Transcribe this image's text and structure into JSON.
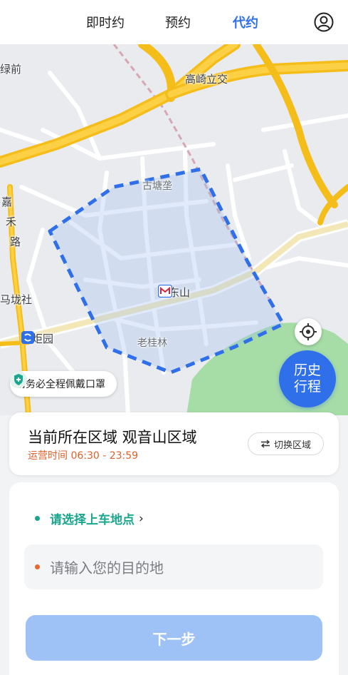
{
  "tabs": [
    {
      "label": "即时约",
      "active": false
    },
    {
      "label": "预约",
      "active": false
    },
    {
      "label": "代约",
      "active": true
    }
  ],
  "header": {
    "user_icon": "user-icon"
  },
  "map": {
    "labels": {
      "lu_qian": "绿前",
      "gaoqi": "高崎立交",
      "gutangke": "古塘垄",
      "jiahe_road": [
        "嘉",
        "禾",
        "路"
      ],
      "malongshe": "马垅社",
      "xiaodongshan": "小东山",
      "huojuyuan": "火炬园",
      "laoguilin": "老桂林",
      "edge_char": "禾"
    },
    "service_area_color": "#2f6fea"
  },
  "locate_button": {
    "icon": "locate-icon"
  },
  "history_button": {
    "line1": "历史",
    "line2": "行程"
  },
  "mask_tip": {
    "icon": "shield-plus-icon",
    "text": "请务必全程佩戴口罩"
  },
  "area_card": {
    "title": "当前所在区域 观音山区域",
    "hours": "运营时间 06:30 - 23:59",
    "switch_label": "切换区域",
    "switch_icon": "swap-arrows-icon"
  },
  "form": {
    "pickup_label": "请选择上车地点",
    "pickup_chevron": "›",
    "destination_placeholder": "请输入您的目的地",
    "next_label": "下一步"
  },
  "colors": {
    "accent": "#2f6fea",
    "pickup_green": "#1aa58d",
    "dest_orange": "#e8682f",
    "hours_orange": "#e0612b",
    "next_disabled": "#9ec1f6"
  }
}
